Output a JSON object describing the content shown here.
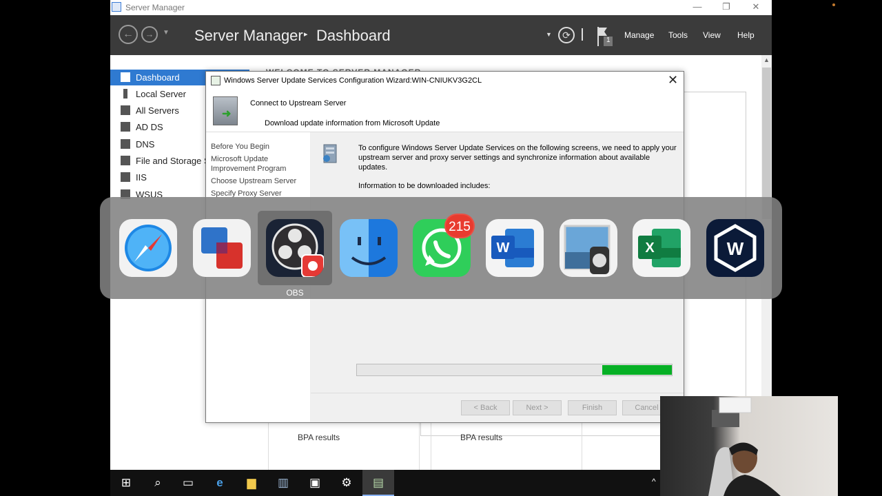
{
  "window": {
    "title": "Server Manager",
    "controls": [
      "—",
      "❐",
      "✕"
    ]
  },
  "header": {
    "app_title": "Server Manager",
    "separator": "▸",
    "page": "Dashboard",
    "notification_count": "1",
    "menu": [
      "Manage",
      "Tools",
      "View",
      "Help"
    ]
  },
  "sidebar": {
    "items": [
      {
        "label": "Dashboard",
        "active": true
      },
      {
        "label": "Local Server"
      },
      {
        "label": "All Servers"
      },
      {
        "label": "AD DS"
      },
      {
        "label": "DNS"
      },
      {
        "label": "File and Storage S"
      },
      {
        "label": "IIS"
      },
      {
        "label": "WSUS"
      }
    ]
  },
  "content": {
    "welcome": "WELCOME TO SERVER MANAGER",
    "bpa_1": "BPA results",
    "bpa_2": "BPA results"
  },
  "wizard": {
    "title": "Windows Server Update Services Configuration Wizard:WIN-CNIUKV3G2CL",
    "heading": "Connect to Upstream Server",
    "subheading": "Download update information from Microsoft Update",
    "steps": [
      "Before You Begin",
      "Microsoft Update Improvement Program",
      "Choose Upstream Server",
      "Specify Proxy Server"
    ],
    "description": "To configure Windows Server Update Services on the following screens, we need to apply your upstream server and proxy server settings and synchronize information about available updates.",
    "info": "Information to be downloaded includes:",
    "progress": 0.22,
    "buttons": {
      "back": "< Back",
      "next": "Next >",
      "finish": "Finish",
      "cancel": "Cancel"
    }
  },
  "app_switcher": {
    "apps": [
      "Safari",
      "Parallels Desktop",
      "OBS",
      "Finder",
      "WhatsApp",
      "Microsoft Word",
      "Preview",
      "Microsoft Excel",
      "Windscribe"
    ],
    "selected_label": "OBS",
    "whatsapp_badge": "215"
  },
  "colors": {
    "header": "#3b3b3b",
    "accent": "#2f7ad1",
    "progress": "#06b025",
    "badge": "#e83b2f"
  }
}
